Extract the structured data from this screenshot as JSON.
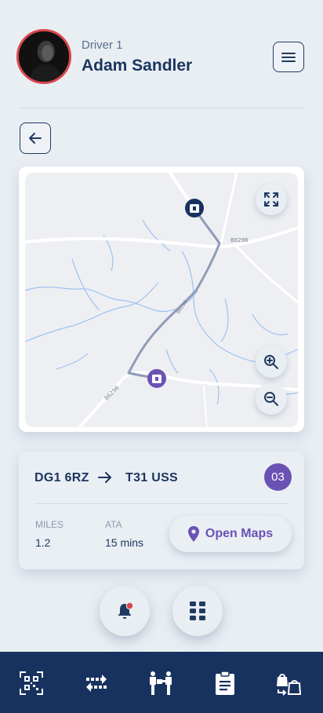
{
  "header": {
    "driver_label": "Driver 1",
    "driver_name": "Adam Sandler"
  },
  "map": {
    "road_labels": [
      "B6296",
      "B6296",
      "B6296"
    ],
    "icons": [
      "expand-icon",
      "zoom-in-icon",
      "zoom-out-icon",
      "start-marker-icon",
      "end-marker-icon"
    ]
  },
  "route": {
    "from": "DG1 6RZ",
    "to": "T31 USS",
    "stop_count": "03",
    "miles_label": "MILES",
    "miles_value": "1.2",
    "ata_label": "ATA",
    "ata_value": "15 mins",
    "open_maps_label": "Open Maps"
  },
  "actions": {
    "notifications_has_alert": true
  },
  "bottom_nav": {
    "items": [
      "qr-scan-icon",
      "transfer-icon",
      "delivery-icon",
      "clipboard-icon",
      "bags-exchange-icon"
    ]
  },
  "colors": {
    "primary_navy": "#17325e",
    "accent_purple": "#6a52b4",
    "alert_red": "#d9474e",
    "background": "#e9eef3"
  }
}
